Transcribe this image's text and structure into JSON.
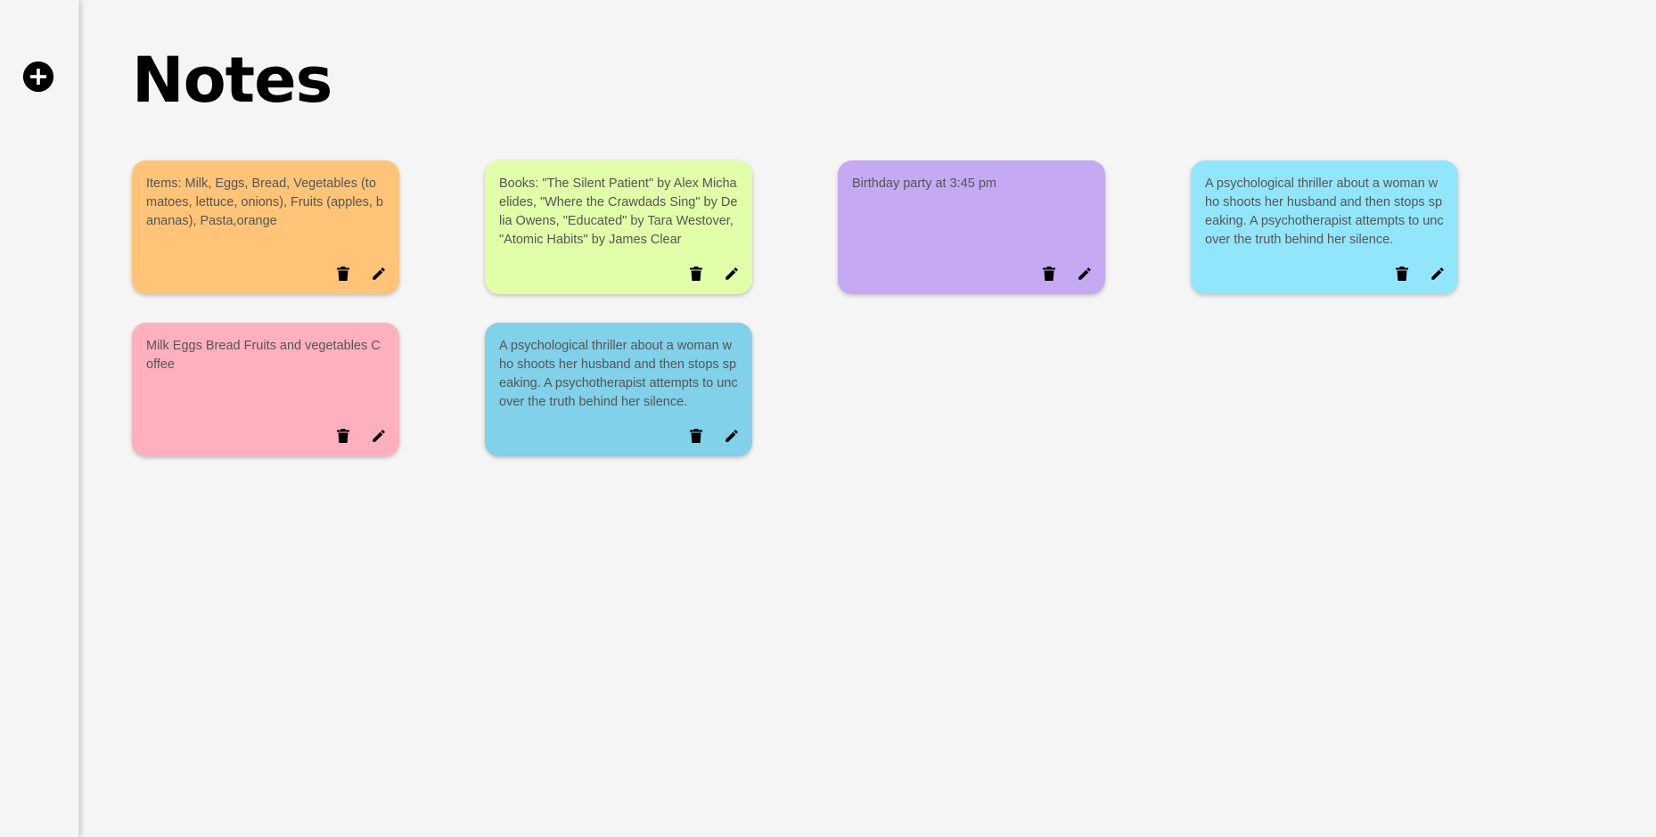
{
  "sidebar": {
    "add_icon": "plus-circle-icon"
  },
  "header": {
    "title": "Notes"
  },
  "notes": [
    {
      "text": "Items: Milk, Eggs, Bread, Vegetables (tomatoes, lettuce, onions), Fruits (apples, bananas), Pasta,orange",
      "color": "#ffc478"
    },
    {
      "text": "Books: \"The Silent Patient\" by Alex Michaelides, \"Where the Crawdads Sing\" by Delia Owens, \"Educated\" by Tara Westover, \"Atomic Habits\" by James Clear",
      "color": "#e1fea9"
    },
    {
      "text": "Birthday party at 3:45 pm",
      "color": "#c5a9f3"
    },
    {
      "text": "A psychological thriller about a woman who shoots her husband and then stops speaking. A psychotherapist attempts to uncover the truth behind her silence.",
      "color": "#92e6fb"
    },
    {
      "text": "Milk Eggs Bread Fruits and vegetables Coffee",
      "color": "#ffb0bf"
    },
    {
      "text": "A psychological thriller about a woman who shoots her husband and then stops speaking. A psychotherapist attempts to uncover the truth behind her silence.",
      "color": "#80d1e9"
    }
  ],
  "note_actions": {
    "delete_icon": "trash-icon",
    "edit_icon": "pencil-icon"
  }
}
